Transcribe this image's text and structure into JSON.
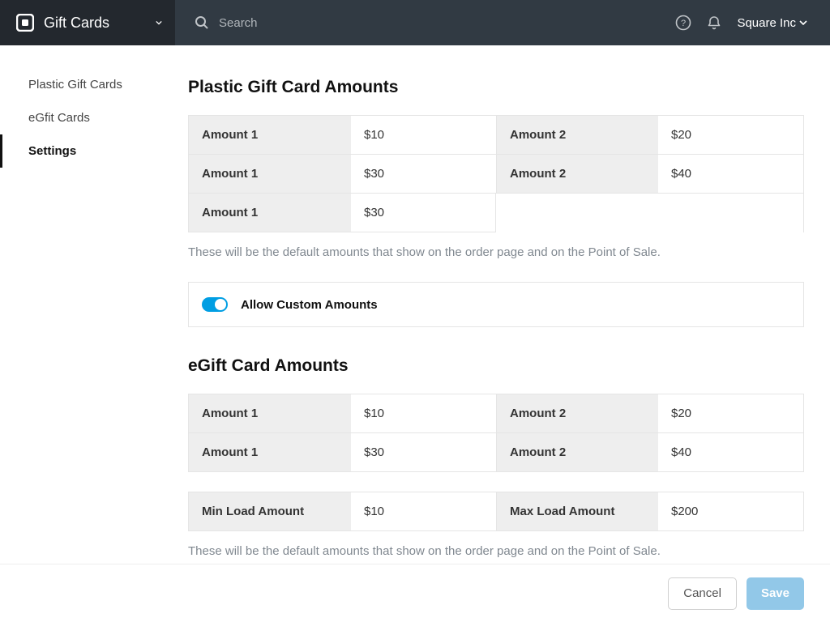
{
  "header": {
    "app_title": "Gift Cards",
    "search_placeholder": "Search",
    "account_label": "Square Inc"
  },
  "sidebar": {
    "items": [
      {
        "label": "Plastic Gift Cards"
      },
      {
        "label": "eGfit Cards"
      },
      {
        "label": "Settings"
      }
    ],
    "active_index": 2
  },
  "plastic": {
    "title": "Plastic Gift Card Amounts",
    "rows": [
      {
        "left_label": "Amount 1",
        "left_value": "$10",
        "right_label": "Amount 2",
        "right_value": "$20"
      },
      {
        "left_label": "Amount 1",
        "left_value": "$30",
        "right_label": "Amount 2",
        "right_value": "$40"
      }
    ],
    "extra_row": {
      "left_label": "Amount 1",
      "left_value": "$30"
    },
    "helper": "These will be the default amounts that show on the order page and on the Point of Sale."
  },
  "toggle": {
    "label": "Allow Custom Amounts",
    "checked": true
  },
  "egift": {
    "title": "eGift Card Amounts",
    "rows": [
      {
        "left_label": "Amount 1",
        "left_value": "$10",
        "right_label": "Amount 2",
        "right_value": "$20"
      },
      {
        "left_label": "Amount 1",
        "left_value": "$30",
        "right_label": "Amount 2",
        "right_value": "$40"
      }
    ],
    "limits": {
      "min_label": "Min Load Amount",
      "min_value": "$10",
      "max_label": "Max Load Amount",
      "max_value": "$200"
    },
    "helper": "These will be the default amounts that show on the order page and on the Point of Sale."
  },
  "footer": {
    "cancel": "Cancel",
    "save": "Save"
  }
}
